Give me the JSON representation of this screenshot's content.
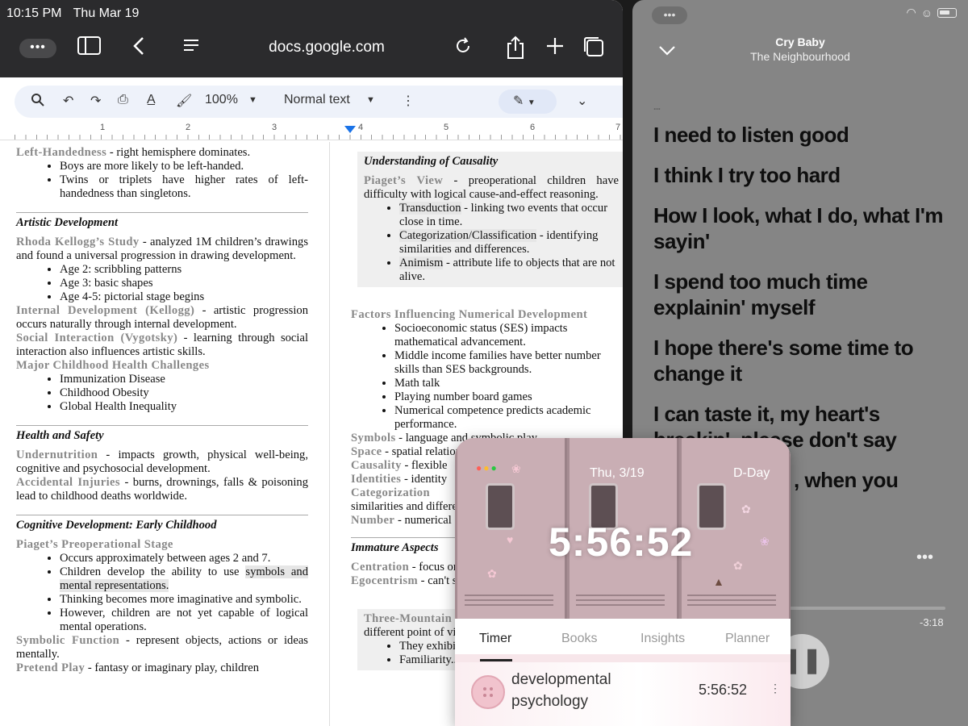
{
  "status_bar": {
    "time": "10:15 PM",
    "date": "Thu Mar 19"
  },
  "safari": {
    "url": "docs.google.com",
    "tabs_button": "•••"
  },
  "docs_toolbar": {
    "zoom": "100%",
    "style": "Normal text"
  },
  "ruler": {
    "numbers": [
      "1",
      "2",
      "3",
      "4",
      "5",
      "6",
      "7"
    ]
  },
  "doc": {
    "col1": {
      "left_handedness": {
        "term": "Left-Handedness",
        "text": " - right hemisphere dominates.",
        "bullets": [
          "Boys are more likely to be left-handed.",
          "Twins or triplets have higher rates of left-handedness than singletons."
        ]
      },
      "artistic": {
        "heading": "Artistic Development",
        "kellogg_term": "Rhoda Kellogg’s Study",
        "kellogg_text": " - analyzed 1M children’s drawings and found a universal progression in drawing development.",
        "bullets": [
          "Age 2: scribbling patterns",
          "Age 3: basic shapes",
          "Age 4-5: pictorial stage begins"
        ],
        "internal_term": "Internal Development (Kellogg)",
        "internal_text": " - artistic progression occurs naturally through internal development.",
        "social_term": "Social Interaction (Vygotsky)",
        "social_text": " - learning through social interaction also influences artistic skills.",
        "health_term": "Major Childhood Health Challenges",
        "health_bullets": [
          "Immunization Disease",
          "Childhood Obesity",
          "Global Health Inequality"
        ]
      },
      "health_safety": {
        "heading": "Health and Safety",
        "under_term": "Undernutrition",
        "under_text": " - impacts growth, physical well-being, cognitive and psychosocial development.",
        "acc_term": "Accidental Injuries",
        "acc_text": " - burns, drownings, falls & poisoning lead to childhood deaths worldwide."
      },
      "cognitive": {
        "heading": "Cognitive Development: Early Childhood",
        "stage_term": "Piaget’s Preoperational Stage",
        "b1": "Occurs approximately between ages 2 and 7.",
        "b2_pre": "Children develop the ability to use ",
        "b2_hl": "symbols and mental representations.",
        "b3": "Thinking becomes more imaginative and symbolic.",
        "b4": "However, children are not yet capable of logical mental operations.",
        "sym_term": "Symbolic Function",
        "sym_text": " - represent objects, actions or ideas mentally.",
        "pretend_term": "Pretend Play",
        "pretend_text": " - fantasy or imaginary play, children"
      }
    },
    "col2": {
      "causality": {
        "heading": "Understanding of Causality",
        "view_term": "Piaget’s View",
        "view_text": " - preoperational children have difficulty with logical cause-and-effect reasoning.",
        "bullets": [
          {
            "term": "Transduction",
            "text": " - linking two events that occur close in time."
          },
          {
            "term": "Categorization/Classification",
            "text": " - identifying similarities and differences."
          },
          {
            "term": "Animism",
            "text": " - attribute life to objects that are not alive."
          }
        ]
      },
      "numerical": {
        "term": "Factors Influencing Numerical Development",
        "bullets": [
          "Socioeconomic status (SES) impacts mathematical advancement.",
          "Middle income families have better number skills than SES backgrounds.",
          "Math talk",
          "Playing number board games",
          "Numerical competence predicts academic performance."
        ]
      },
      "lines": [
        {
          "term": "Symbols",
          "text": " - language and symbolic play"
        },
        {
          "term": "Space",
          "text": " - spatial relations"
        },
        {
          "term": "Causality",
          "text": " - flexible"
        },
        {
          "term": "Identities",
          "text": " - identity"
        },
        {
          "term": "Categorization",
          "text": ""
        },
        {
          "term": "",
          "text": "similarities and differences"
        },
        {
          "term": "Number",
          "text": " - numerical"
        }
      ],
      "immature": {
        "heading": "Immature Aspects",
        "cent_term": "Centration",
        "cent_text": " - focus on one aspect and neglect others.",
        "ego_term": "Egocentrism",
        "ego_text": " - can't see another's view that they struggle"
      },
      "three_mountain": {
        "term": "Three-Mountain",
        "text": "different point of view",
        "bullets": [
          "They exhibit... situations.",
          "Familiarity... perspective"
        ]
      }
    }
  },
  "music": {
    "song": "Cry Baby",
    "artist": "The Neighbourhood",
    "faint_line": "...",
    "lyrics": [
      "I need to listen good",
      "I think I try too hard",
      "How I look, what I do, what I'm sayin'",
      "I spend too much time explainin' myself",
      "I hope there's some time to change it",
      "I can taste it, my heart's breakin', please don't say",
      ", when you"
    ],
    "remaining": "-3:18",
    "progress": 0.02
  },
  "timer_app": {
    "date": "Thu, 3/19",
    "dday": "D-Day",
    "clock": "5:56:52",
    "tabs": [
      "Timer",
      "Books",
      "Insights",
      "Planner"
    ],
    "active_tab": "Timer",
    "subject_line1": "developmental",
    "subject_line2": "psychology",
    "subject_time": "5:56:52"
  }
}
